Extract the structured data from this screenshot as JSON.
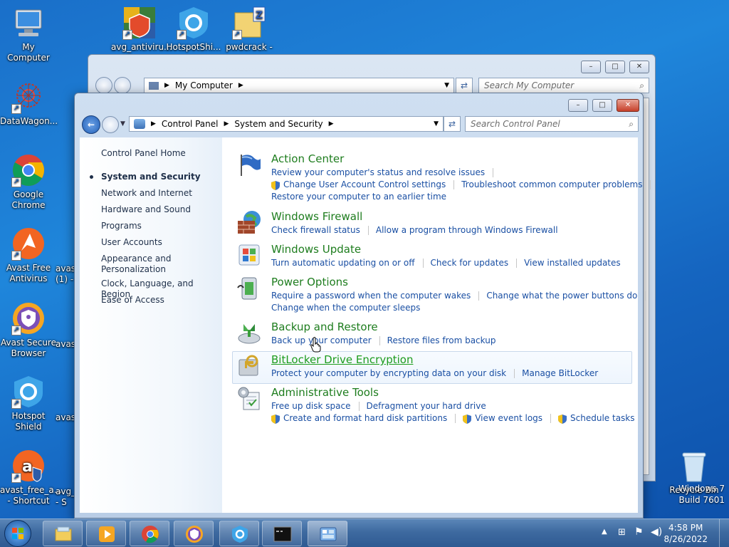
{
  "desktop_icons": [
    {
      "name": "desktop-icon-my-computer",
      "label": "My Computer"
    },
    {
      "name": "desktop-icon-avg-antivirus",
      "label": "avg_antiviru..."
    },
    {
      "name": "desktop-icon-hotspotshield-top",
      "label": "HotspotShi..."
    },
    {
      "name": "desktop-icon-pwdcrack",
      "label": "pwdcrack -"
    },
    {
      "name": "desktop-icon-datawagon",
      "label": "DataWagon..."
    },
    {
      "name": "desktop-icon-chrome",
      "label": "Google Chrome"
    },
    {
      "name": "desktop-icon-avast-free",
      "label": "Avast Free Antivirus"
    },
    {
      "name": "desktop-icon-avast-browser",
      "label": "Avast Secure Browser"
    },
    {
      "name": "desktop-icon-hotspot-shield",
      "label": "Hotspot Shield"
    },
    {
      "name": "desktop-icon-avast-shortcut",
      "label": "avast_free_a... - Shortcut"
    },
    {
      "name": "desktop-icon-recycle-bin",
      "label": "Recycle Bin"
    }
  ],
  "partial_labels": {
    "avas1": "avas (1) -",
    "avas2": "avas",
    "avas3": "avas",
    "avg": "avg_ - S"
  },
  "back_window": {
    "address": "My Computer",
    "search_placeholder": "Search My Computer"
  },
  "front_window": {
    "breadcrumb": [
      "Control Panel",
      "System and Security"
    ],
    "search_placeholder": "Search Control Panel"
  },
  "sidebar": {
    "home": "Control Panel Home",
    "items": [
      {
        "label": "System and Security",
        "active": true
      },
      {
        "label": "Network and Internet"
      },
      {
        "label": "Hardware and Sound"
      },
      {
        "label": "Programs"
      },
      {
        "label": "User Accounts"
      },
      {
        "label": "Appearance and Personalization"
      },
      {
        "label": "Clock, Language, and Region"
      },
      {
        "label": "Ease of Access"
      }
    ]
  },
  "categories": {
    "action_center": {
      "title": "Action Center",
      "l1": [
        "Review your computer's status and resolve issues"
      ],
      "l2": [
        "Change User Account Control settings",
        "Troubleshoot common computer problems"
      ],
      "l3": [
        "Restore your computer to an earlier time"
      ]
    },
    "firewall": {
      "title": "Windows Firewall",
      "l1": [
        "Check firewall status",
        "Allow a program through Windows Firewall"
      ]
    },
    "update": {
      "title": "Windows Update",
      "l1": [
        "Turn automatic updating on or off",
        "Check for updates",
        "View installed updates"
      ]
    },
    "power": {
      "title": "Power Options",
      "l1": [
        "Require a password when the computer wakes",
        "Change what the power buttons do"
      ],
      "l2": [
        "Change when the computer sleeps"
      ]
    },
    "backup": {
      "title": "Backup and Restore",
      "l1": [
        "Back up your computer",
        "Restore files from backup"
      ]
    },
    "bitlocker": {
      "title": "BitLocker Drive Encryption",
      "l1": [
        "Protect your computer by encrypting data on your disk",
        "Manage BitLocker"
      ]
    },
    "admin": {
      "title": "Administrative Tools",
      "l1": [
        "Free up disk space",
        "Defragment your hard drive"
      ],
      "l2": [
        "Create and format hard disk partitions",
        "View event logs",
        "Schedule tasks"
      ]
    }
  },
  "watermark": {
    "line1": "Windows 7",
    "line2": "Build 7601"
  },
  "clock": {
    "time": "4:58 PM",
    "date": "8/26/2022"
  },
  "colors": {
    "link": "#1a4fa3",
    "category_title": "#1e7d1e",
    "sidebar_text": "#1e2f49"
  }
}
